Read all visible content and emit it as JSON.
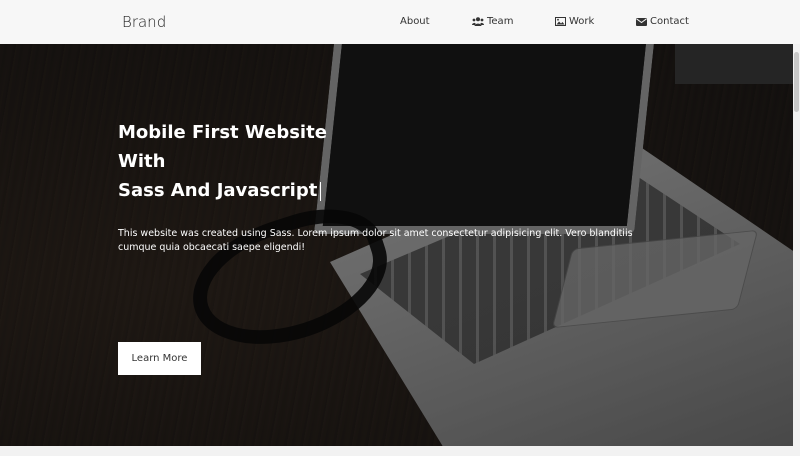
{
  "navbar": {
    "brand": "Brand",
    "items": [
      {
        "label": "About",
        "icon": ""
      },
      {
        "label": "Team",
        "icon": "users-icon"
      },
      {
        "label": "Work",
        "icon": "image-icon"
      },
      {
        "label": "Contact",
        "icon": "envelope-icon"
      }
    ]
  },
  "hero": {
    "title_line1": "Mobile First Website With",
    "title_line2": "Sass And Javascript",
    "text": "This website was created using Sass. Lorem ipsum dolor sit amet consectetur adipisicing elit. Vero blanditiis cumque quia obcaecati saepe eligendi!",
    "button_label": "Learn More"
  },
  "colors": {
    "navbar_bg": "#f7f7f7",
    "hero_text": "#ffffff",
    "button_bg": "#ffffff"
  }
}
